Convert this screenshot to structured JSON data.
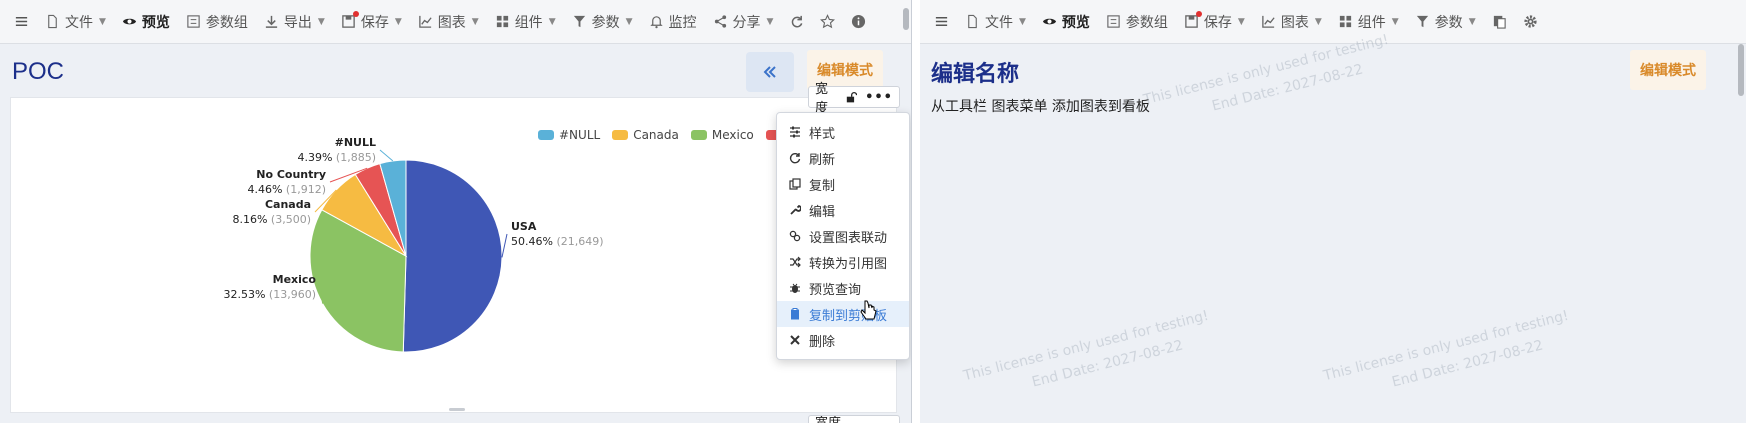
{
  "left": {
    "toolbar": {
      "file": "文件",
      "preview": "预览",
      "param_group": "参数组",
      "export": "导出",
      "save": "保存",
      "chart": "图表",
      "component": "组件",
      "param": "参数",
      "monitor": "监控",
      "share": "分享"
    },
    "title": "POC",
    "edit_mode": "编辑模式",
    "width_chip": "宽度",
    "width_chip_bottom": "宽度",
    "legend": [
      "#NULL",
      "Canada",
      "Mexico",
      "No Country"
    ],
    "legend_visible": [
      "#NULL",
      "Canada",
      "Mexico",
      "N"
    ],
    "menu": [
      "样式",
      "刷新",
      "复制",
      "编辑",
      "设置图表联动",
      "转换为引用图",
      "预览查询",
      "复制到剪贴板",
      "删除"
    ],
    "menu_visible_highlight": "复制到剪贴板"
  },
  "right": {
    "toolbar": {
      "file": "文件",
      "preview": "预览",
      "param_group": "参数组",
      "save": "保存",
      "chart": "图表",
      "component": "组件",
      "param": "参数"
    },
    "title": "编辑名称",
    "edit_mode": "编辑模式",
    "hint": "从工具栏 图表菜单 添加图表到看板"
  },
  "watermarks": [
    "This license is only used for testing!",
    "End Date: 2027-08-22"
  ],
  "colors": {
    "title": "#1c2f8a",
    "edit_mode": "#d98a2a",
    "menu_highlight": "#3a7bd5",
    "usa": "#3f57b5",
    "mexico": "#8bc363",
    "canada": "#f6bb42",
    "no_country": "#e65454",
    "null": "#5ab1d8"
  },
  "chart_data": {
    "type": "pie",
    "title": "",
    "slices": [
      {
        "label": "USA",
        "percent": "50.46%",
        "value": 21649,
        "value_text": "(21,649)",
        "color": "#3f57b5"
      },
      {
        "label": "Mexico",
        "percent": "32.53%",
        "value": 13960,
        "value_text": "(13,960)",
        "color": "#8bc363"
      },
      {
        "label": "Canada",
        "percent": "8.16%",
        "value": 3500,
        "value_text": "(3,500)",
        "color": "#f6bb42"
      },
      {
        "label": "No Country",
        "percent": "4.46%",
        "value": 1912,
        "value_text": "(1,912)",
        "color": "#e65454"
      },
      {
        "label": "#NULL",
        "percent": "4.39%",
        "value": 1885,
        "value_text": "(1,885)",
        "color": "#5ab1d8"
      }
    ],
    "legend_placement": "top-right"
  }
}
